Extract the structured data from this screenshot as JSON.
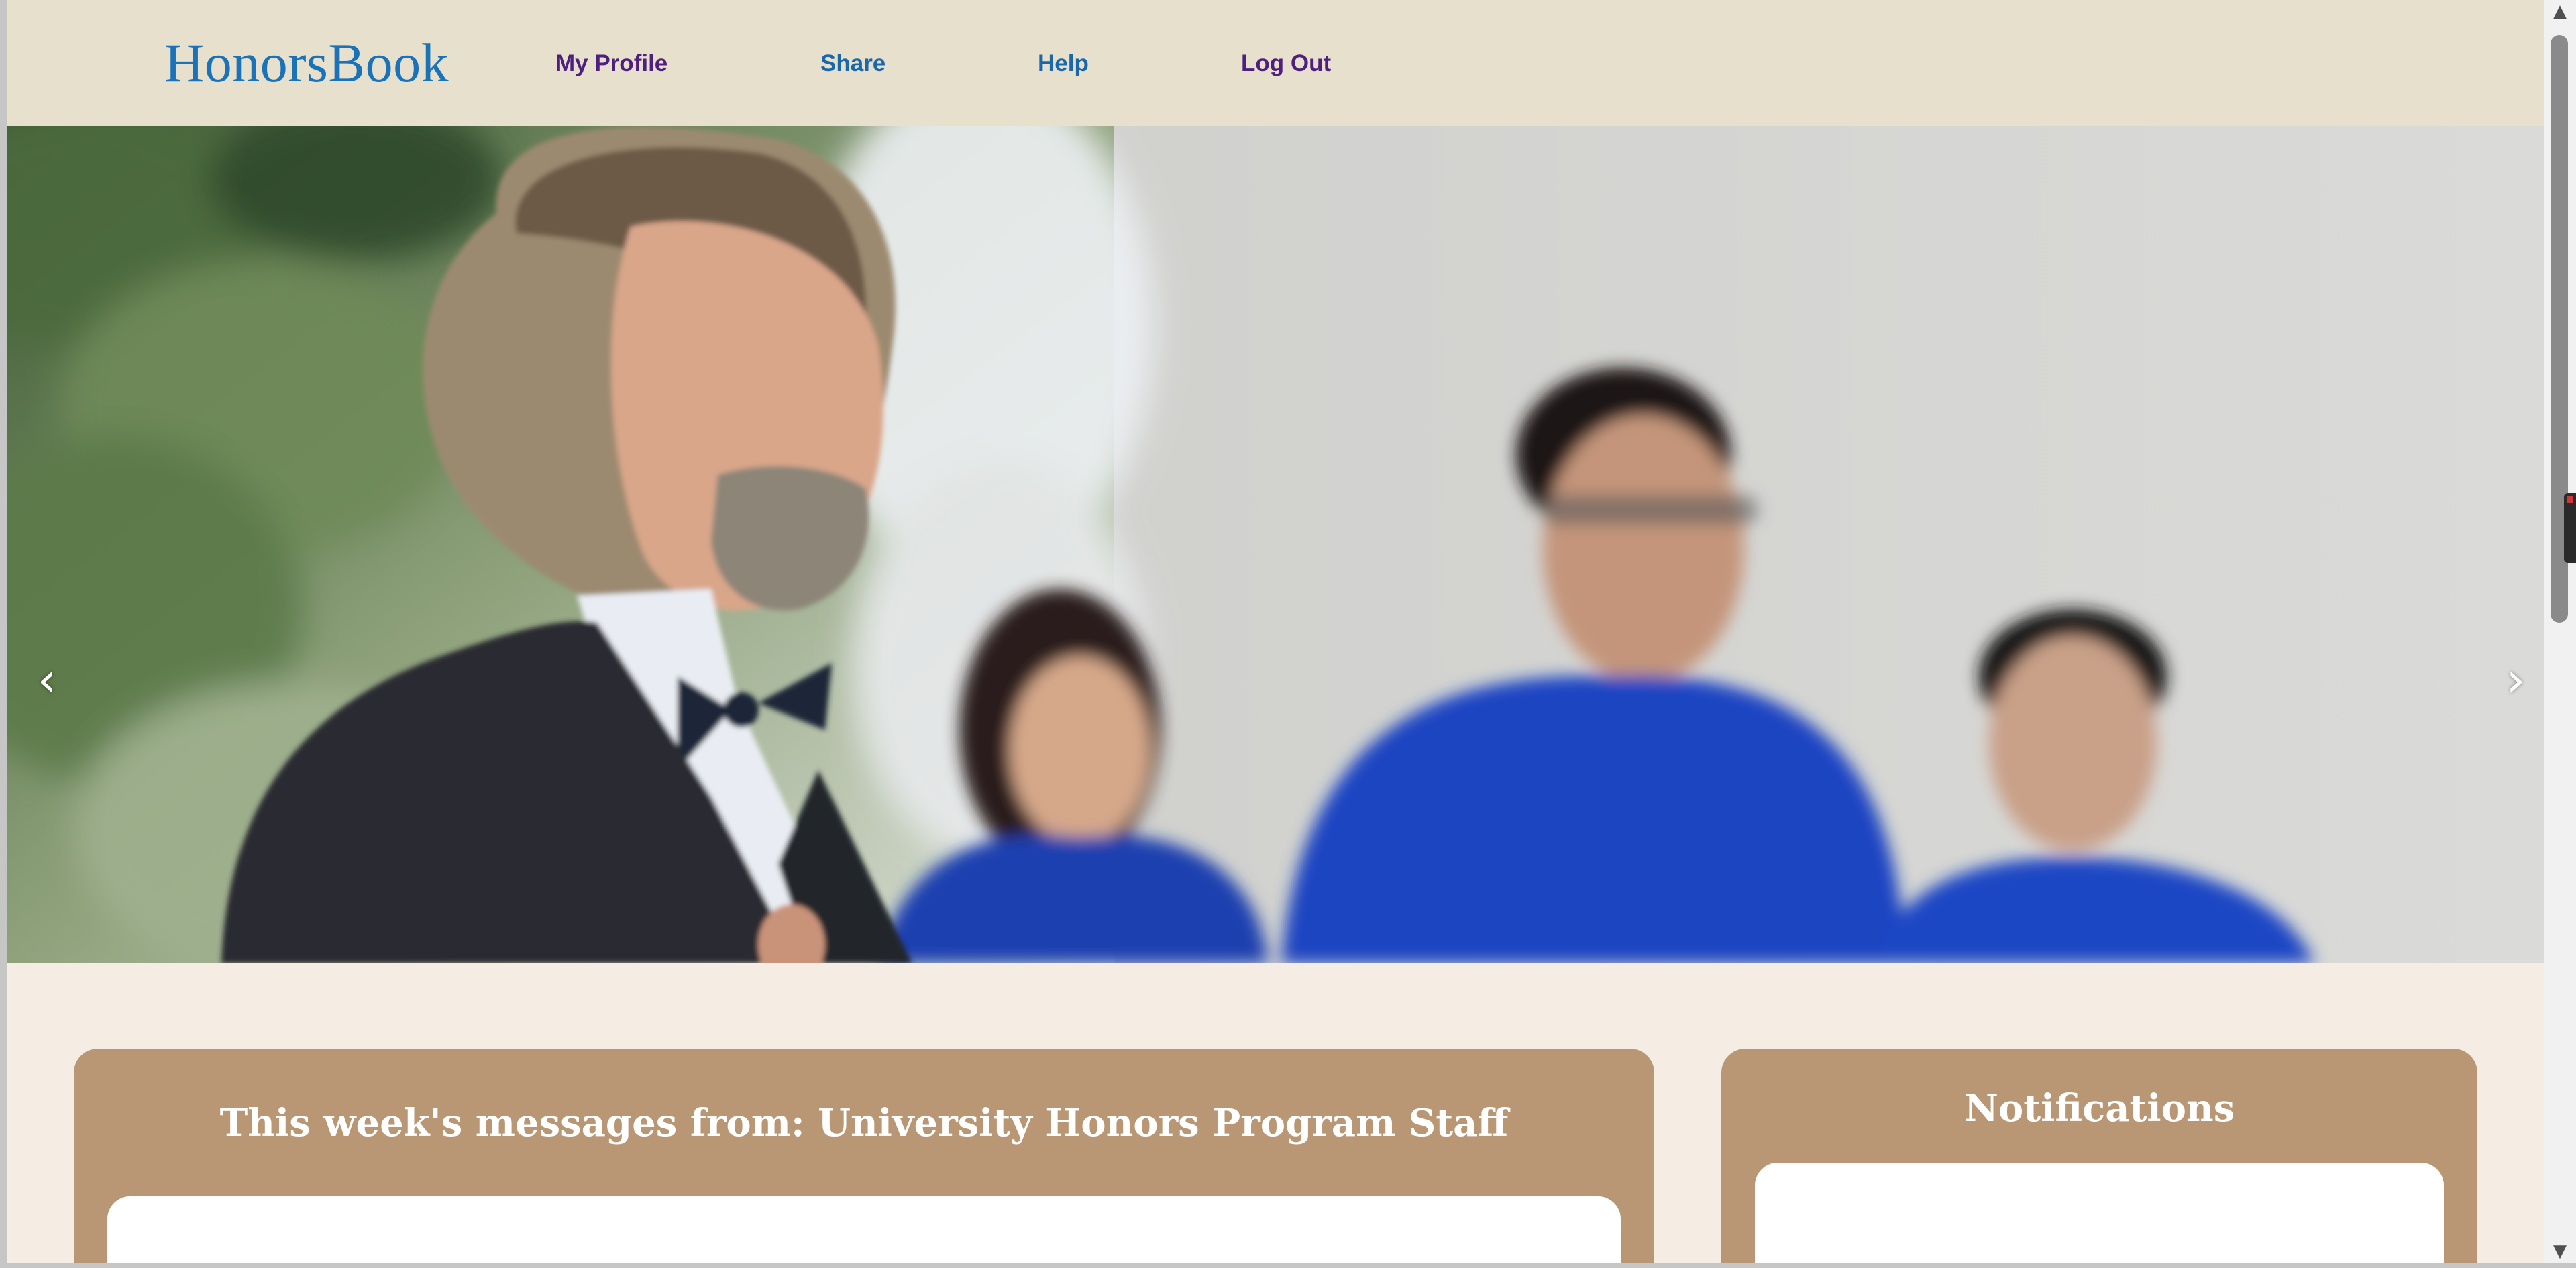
{
  "header": {
    "logo": "HonorsBook",
    "nav": {
      "my_profile": "My Profile",
      "share": "Share",
      "help": "Help",
      "log_out": "Log Out"
    }
  },
  "hero": {
    "prev_arrow": "‹",
    "next_arrow": "›"
  },
  "messages_card": {
    "title": "This week's messages from: University Honors Program Staff"
  },
  "notifications_card": {
    "title": "Notifications"
  },
  "scrollbar": {
    "up_arrow": "▲",
    "down_arrow": "▼"
  },
  "colors": {
    "header_bg": "#e6e0cc",
    "page_bg": "#f5ece3",
    "card_bg": "#b99774",
    "logo_blue": "#1a73b8",
    "nav_purple": "#4e1f7f",
    "nav_blue": "#1b67ab"
  }
}
